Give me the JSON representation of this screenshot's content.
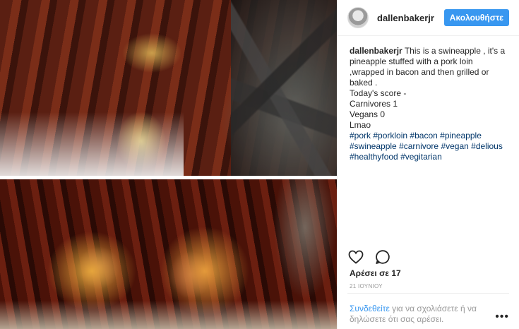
{
  "post": {
    "images": [
      {
        "alt": ""
      },
      {
        "alt": ""
      }
    ]
  },
  "header": {
    "username": "dallenbakerjr",
    "follow_label": "Ακολουθήστε"
  },
  "caption": {
    "author": "dallenbakerjr",
    "line1": " This is a swineapple , it's a pineapple stuffed with a pork loin ,wrapped in bacon and then grilled or baked .",
    "line2": "Today's score -",
    "line3": "Carnivores 1",
    "line4": "Vegans 0",
    "line5": "Lmao",
    "hashtags": [
      "#pork",
      "#porkloin",
      "#bacon",
      "#pineapple",
      "#swineapple",
      "#carnivore",
      "#vegan",
      "#delious",
      "#healthyfood",
      "#vegitarian"
    ]
  },
  "actions": {
    "like_icon": "heart-icon",
    "comment_icon": "comment-icon"
  },
  "likes_text": "Αρέσει σε 17",
  "date_text": "21 ΙΟΥΝΙΟΥ",
  "login": {
    "link_text": "Συνδεθείτε",
    "rest_text": " για να σχολιάσετε ή να δηλώσετε ότι σας αρέσει."
  },
  "more_icon": "more-options-icon",
  "colors": {
    "accent": "#3897f0",
    "hashtag": "#003569",
    "muted": "#999999"
  }
}
